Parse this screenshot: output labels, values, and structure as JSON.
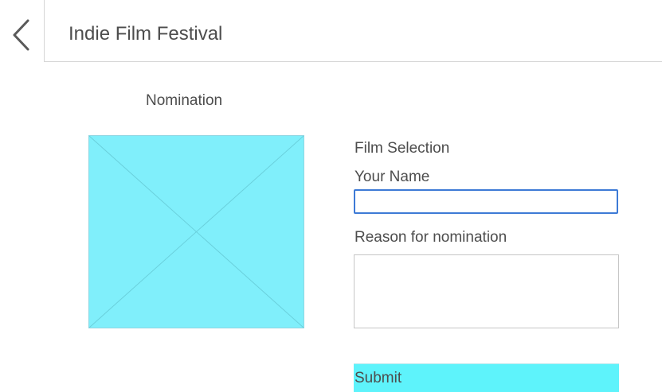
{
  "header": {
    "back_icon": "chevron-left-icon",
    "title": "Indie Film Festival"
  },
  "main": {
    "section_title": "Nomination",
    "image": {
      "type": "image-placeholder",
      "fill_color": "#80effb"
    },
    "form": {
      "film_selection_label": "Film Selection",
      "name_label": "Your Name",
      "name_value": "",
      "reason_label": "Reason for nomination",
      "reason_value": "",
      "submit_label": "Submit"
    }
  },
  "colors": {
    "accent": "#5ef3fb",
    "focus_border": "#3d7ad6",
    "placeholder_fill": "#80effb",
    "text": "#4d4d4d"
  }
}
